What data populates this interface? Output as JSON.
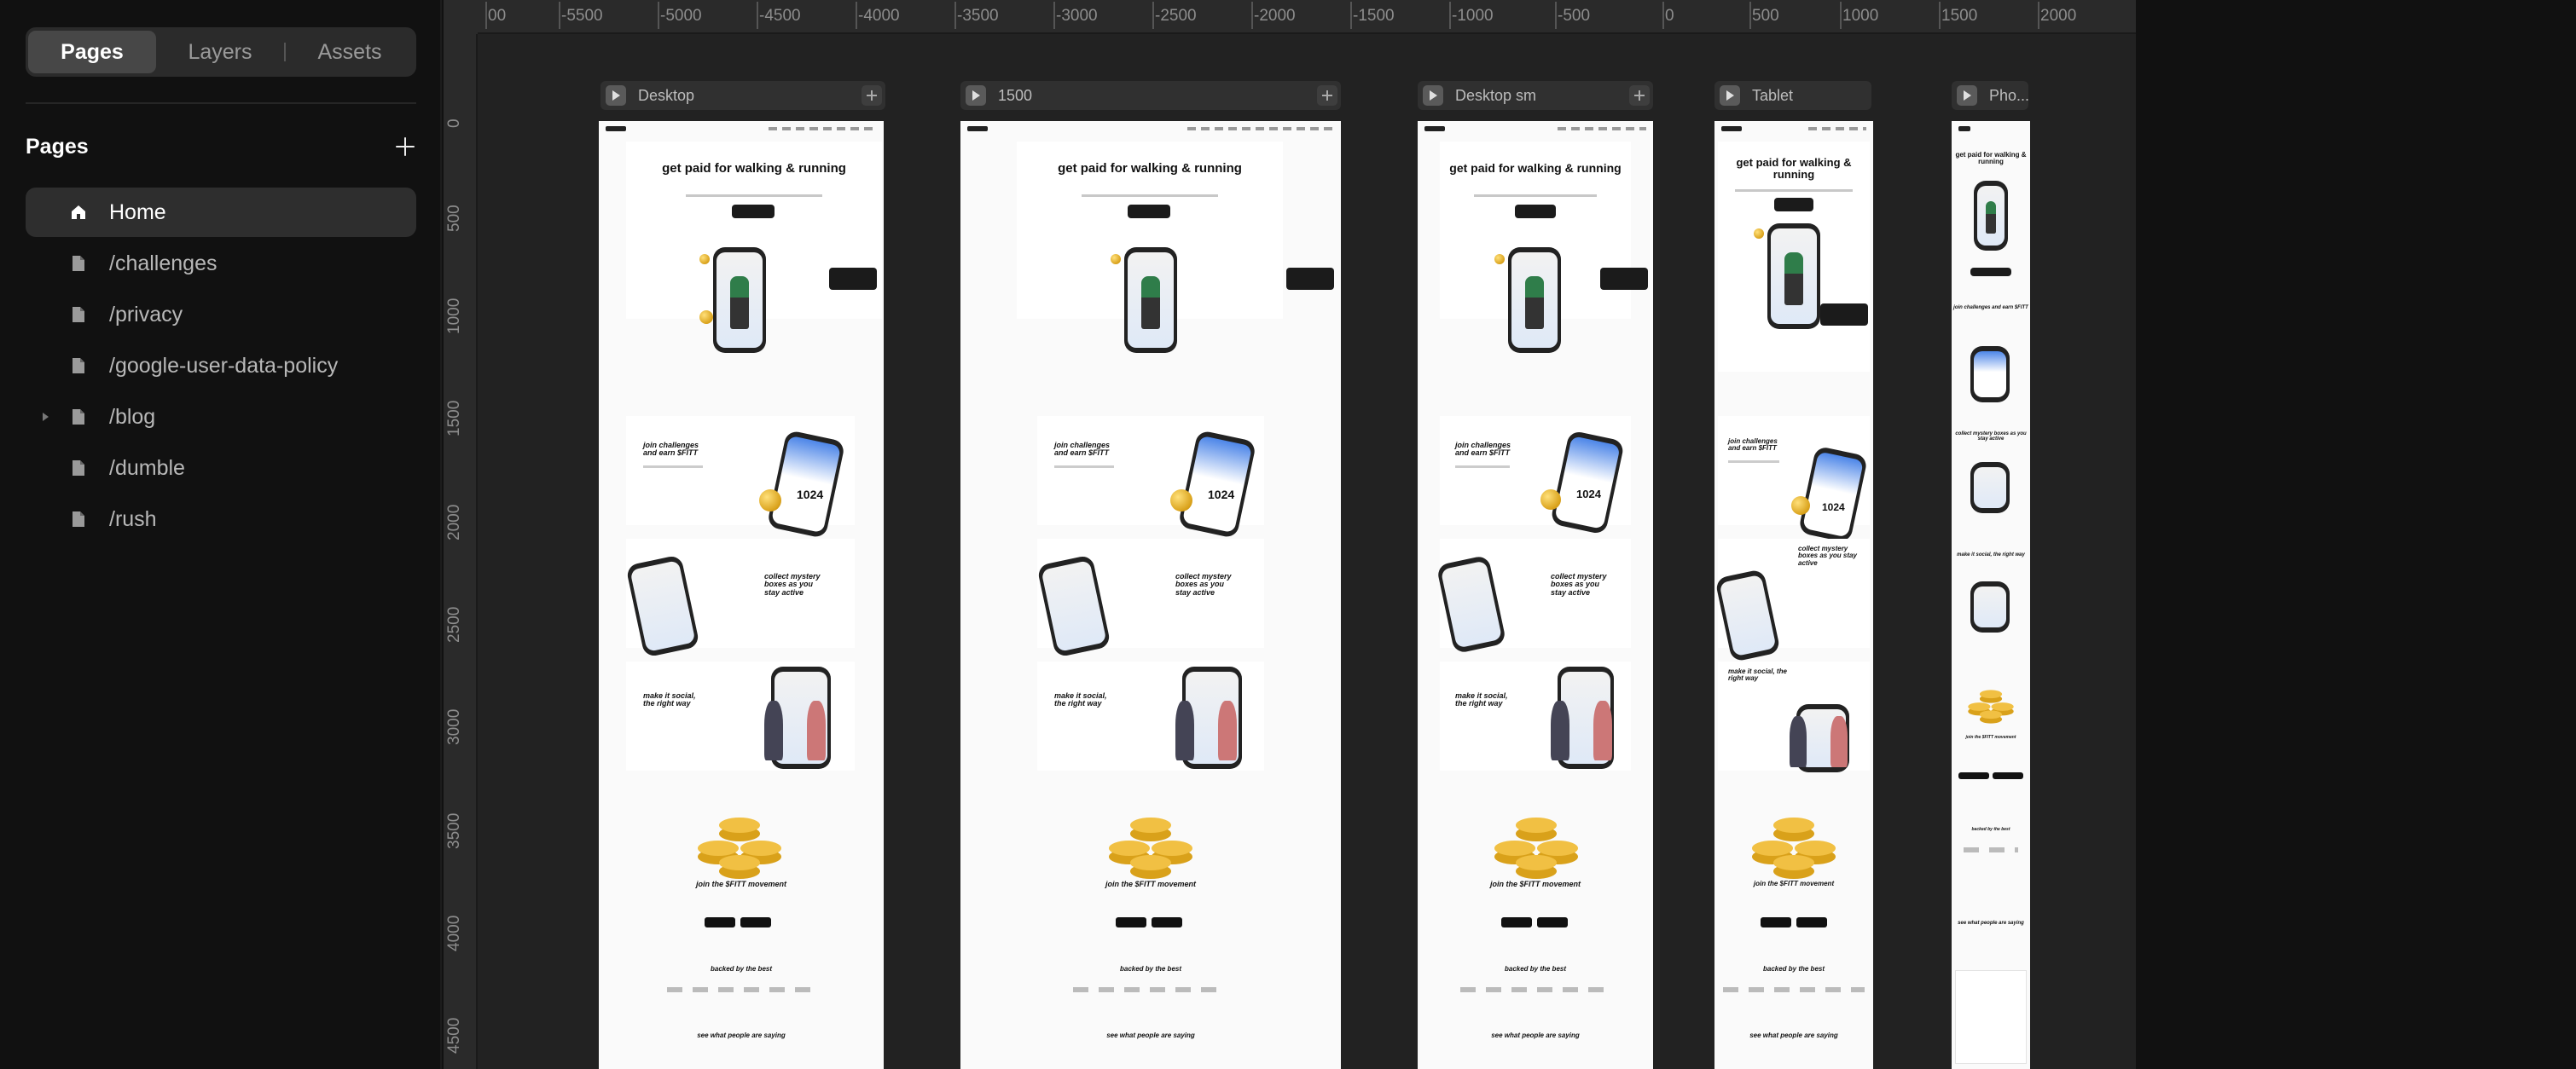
{
  "sidebar": {
    "tabs": [
      {
        "label": "Pages",
        "active": true
      },
      {
        "label": "Layers",
        "active": false
      },
      {
        "label": "Assets",
        "active": false
      }
    ],
    "section_title": "Pages",
    "pages": [
      {
        "label": "Home",
        "icon": "home-icon",
        "active": true,
        "expandable": false
      },
      {
        "label": "/challenges",
        "icon": "page-icon",
        "active": false,
        "expandable": false
      },
      {
        "label": "/privacy",
        "icon": "page-icon",
        "active": false,
        "expandable": false
      },
      {
        "label": "/google-user-data-policy",
        "icon": "page-icon",
        "active": false,
        "expandable": false
      },
      {
        "label": "/blog",
        "icon": "page-icon",
        "active": false,
        "expandable": true
      },
      {
        "label": "/dumble",
        "icon": "page-icon",
        "active": false,
        "expandable": false
      },
      {
        "label": "/rush",
        "icon": "page-icon",
        "active": false,
        "expandable": false
      }
    ]
  },
  "canvas": {
    "ruler_x": [
      "-5500",
      "-5000",
      "-4500",
      "-4000",
      "-3500",
      "-3000",
      "-2500",
      "-2000",
      "-1500",
      "-1000",
      "-500",
      "0",
      "500",
      "1000",
      "1500",
      "2000"
    ],
    "ruler_x_cut": "00",
    "ruler_y": [
      "0",
      "500",
      "1000",
      "1500",
      "2000",
      "2500",
      "3000",
      "3500",
      "4000",
      "4500"
    ],
    "frames": [
      {
        "name": "Desktop"
      },
      {
        "name": "1500"
      },
      {
        "name": "Desktop sm"
      },
      {
        "name": "Tablet"
      },
      {
        "name": "Pho..."
      }
    ]
  },
  "site_preview": {
    "hero_title": "get paid for walking & running",
    "challenges_title": "join challenges and earn $FITT",
    "challenges_number": "1024",
    "mystery_title": "collect mystery boxes as you stay active",
    "social_title": "make it social, the right way",
    "movement_title": "join the $FITT movement",
    "backed_title": "backed by the best",
    "testimonials_title": "see what people are saying"
  },
  "colors": {
    "canvas_bg": "#222222",
    "sidebar_bg": "#111111",
    "active_tab": "#474747",
    "coin_gold": "#d9a11a"
  }
}
